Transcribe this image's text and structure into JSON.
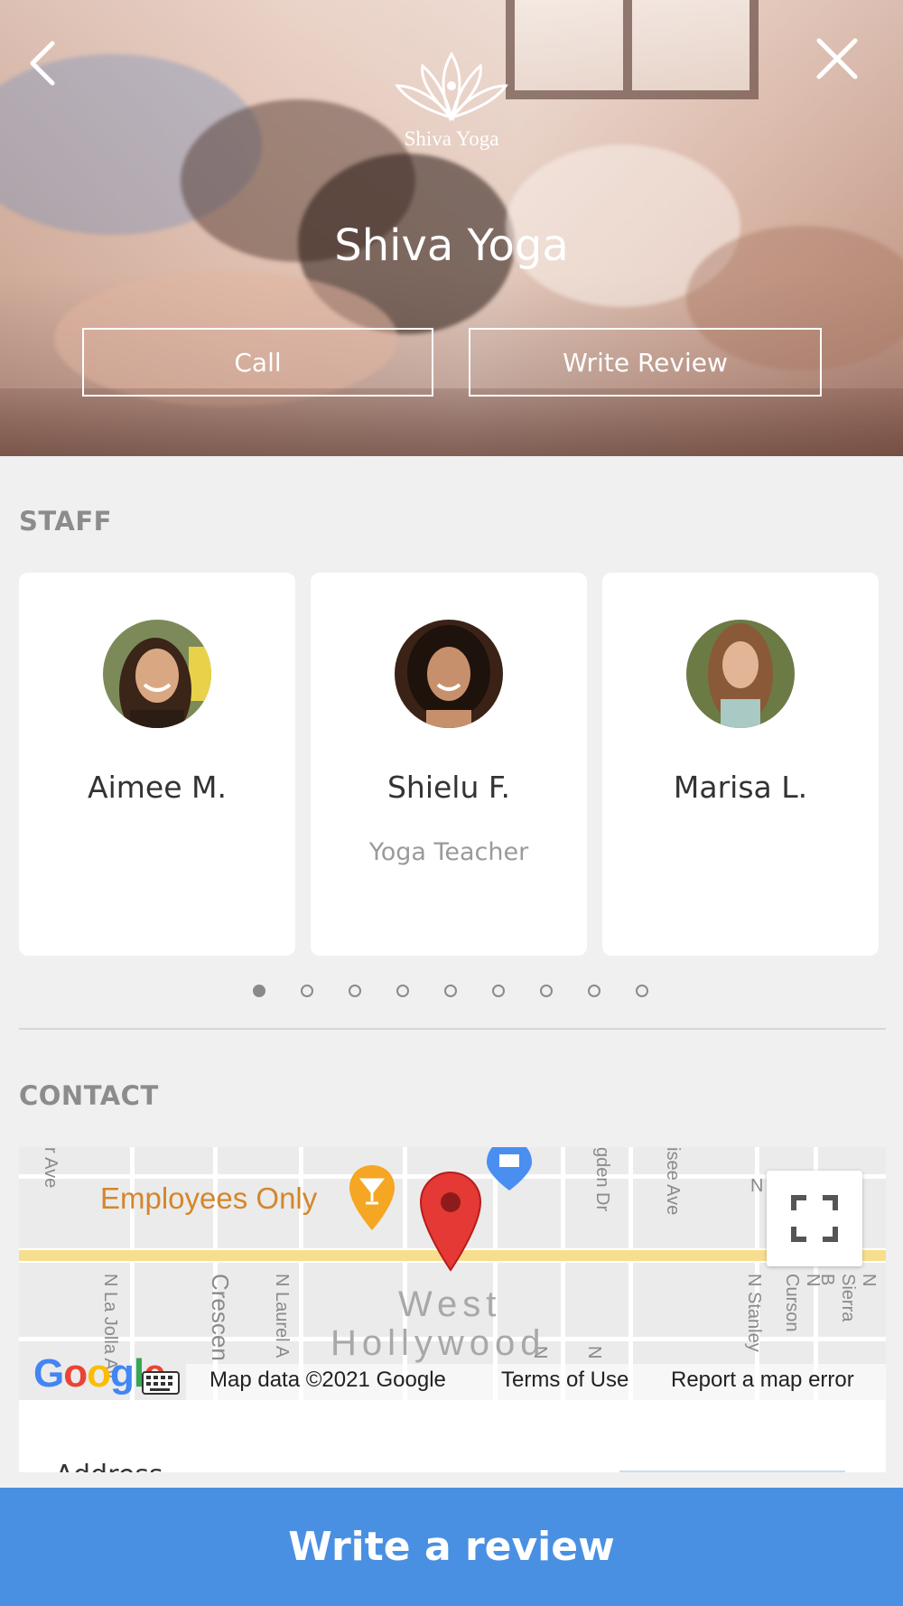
{
  "header": {
    "logo_text": "Shiva Yoga",
    "title": "Shiva Yoga",
    "call_label": "Call",
    "write_review_label": "Write Review",
    "back_icon": "chevron-left-icon",
    "close_icon": "close-icon"
  },
  "staff": {
    "section_title": "STAFF",
    "members": [
      {
        "name": "Aimee M.",
        "role": ""
      },
      {
        "name": "Shielu F.",
        "role": "Yoga Teacher"
      },
      {
        "name": "Marisa L.",
        "role": ""
      }
    ],
    "pagination": {
      "total": 9,
      "active": 1
    }
  },
  "contact": {
    "section_title": "CONTACT",
    "map": {
      "poi_label": "Employees Only",
      "area_line1": "West",
      "area_line2": "Hollywood",
      "streets": [
        "r Ave",
        "gden Dr",
        "isee Ave",
        "N",
        "N La Jolla Av",
        "Crescen",
        "N Laurel A",
        "N",
        "N",
        "N Stanley",
        "N Curson",
        "N Sierra B"
      ],
      "attribution": "Map data ©2021 Google",
      "terms": "Terms of Use",
      "report": "Report a map error",
      "google_logo": "Google"
    },
    "address_label": "Address"
  },
  "footer": {
    "write_review_label": "Write a review"
  },
  "colors": {
    "accent": "#4a90e2",
    "marker": "#e53935",
    "poi": "#f5a623"
  }
}
